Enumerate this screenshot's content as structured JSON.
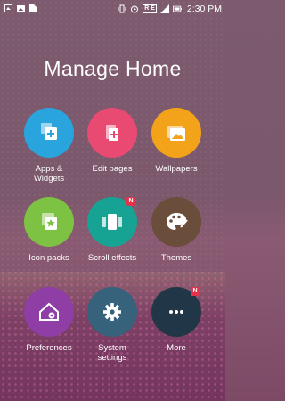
{
  "status_bar": {
    "time": "2:30 PM",
    "left_icons": [
      "image-icon",
      "image-icon",
      "file-icon"
    ],
    "right_icons": [
      "vibrate-icon",
      "alarm-icon",
      "ne-icon",
      "signal-icon",
      "battery-icon"
    ],
    "ne_text": "R E"
  },
  "title": "Manage Home",
  "tiles": [
    {
      "label": "Apps &\nWidgets",
      "color": "#2aa4dc",
      "icon": "apps-widgets-icon",
      "badge": ""
    },
    {
      "label": "Edit pages",
      "color": "#e84a72",
      "icon": "edit-pages-icon",
      "badge": ""
    },
    {
      "label": "Wallpapers",
      "color": "#f2a31a",
      "icon": "wallpapers-icon",
      "badge": ""
    },
    {
      "label": "Icon packs",
      "color": "#7dc242",
      "icon": "icon-packs-icon",
      "badge": ""
    },
    {
      "label": "Scroll effects",
      "color": "#16a394",
      "icon": "scroll-effects-icon",
      "badge": "N"
    },
    {
      "label": "Themes",
      "color": "#6a4d3b",
      "icon": "themes-icon",
      "badge": ""
    },
    {
      "label": "Preferences",
      "color": "#8e3ea4",
      "icon": "preferences-icon",
      "badge": ""
    },
    {
      "label": "System\nsettings",
      "color": "#36627c",
      "icon": "settings-gear-icon",
      "badge": ""
    },
    {
      "label": "More",
      "color": "#213748",
      "icon": "more-dots-icon",
      "badge": "N"
    }
  ]
}
